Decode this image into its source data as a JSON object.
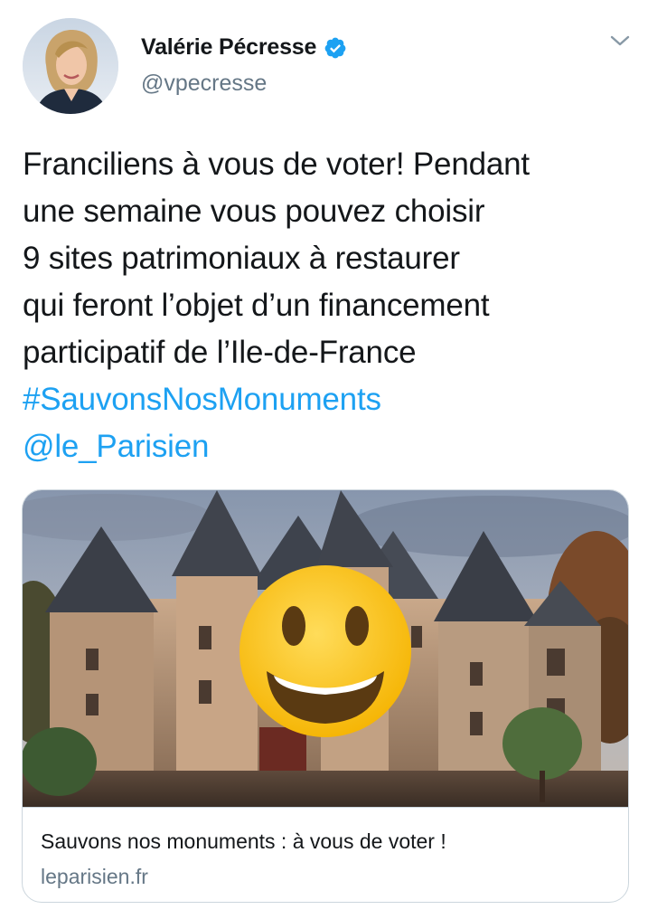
{
  "user": {
    "display_name": "Valérie Pécresse",
    "handle": "@vpecresse",
    "verified": true,
    "avatar_icon": "profile-photo"
  },
  "tweet": {
    "lines": [
      "Franciliens à vous de voter! Pendant",
      "une semaine vous pouvez choisir",
      "9 sites patrimoniaux à restaurer",
      "qui feront l’objet d’un financement",
      "participatif de l’Ile-de-France"
    ],
    "hashtag": "#SauvonsNosMonuments",
    "mention": "@le_Parisien"
  },
  "card": {
    "title": "Sauvons nos monuments : à vous de voter !",
    "domain": "leparisien.fr",
    "image_icon": "castle-photo-with-smiley-emoji"
  },
  "colors": {
    "link": "#1da1f2",
    "text": "#14171a",
    "secondary": "#657786",
    "border": "#ccd6dd",
    "verified": "#1da1f2"
  }
}
